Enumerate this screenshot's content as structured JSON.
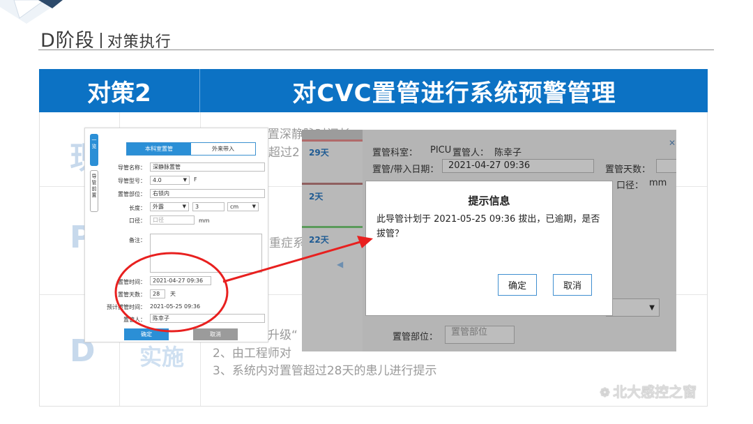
{
  "slide": {
    "title_main": "D阶段",
    "title_sub": "对策执行",
    "header_left": "对策2",
    "header_right": "对CVC置管进行系统预警管理",
    "watermark": "北大感控之窗",
    "colors": {
      "header": "#0c72c4",
      "accent_red": "#e8201f"
    }
  },
  "background_text": {
    "line1": "1、患儿留置深静脉时间长",
    "line2": "超过2",
    "line3": "重症系",
    "line4": "升级“",
    "line5": "2、由工程师对",
    "line6": "3、系统内对置管超过28天的患儿进行提示",
    "phase_word": "实施",
    "letter_1": "现",
    "letter_2": "P",
    "letter_3": "D"
  },
  "form": {
    "side_tabs": [
      "一览",
      "导管前置"
    ],
    "tabs": [
      "本科室置管",
      "外来带入"
    ],
    "fields": {
      "name_label": "导管名称：",
      "name_value": "深静脉置管",
      "type_label": "导管型号：",
      "type_value": "4.0",
      "type_unit": "F",
      "site_label": "置管部位：",
      "site_value": "右锁内",
      "length_label": "长度：",
      "length_select": "外露",
      "length_value": "3",
      "length_unit": "cm",
      "diameter_label": "口径：",
      "diameter_placeholder": "口径",
      "diameter_unit": "mm",
      "note_label": "备注：",
      "time_label": "置管时间：",
      "time_value": "2021-04-27   09:36",
      "days_label": "置管天数：",
      "days_value": "28",
      "days_unit": "天",
      "planned_label": "预计拔管时间：",
      "planned_value": "2021-05-25 09:36",
      "person_label": "置管人：",
      "person_value": "陈幸子"
    },
    "confirm_label": "确定",
    "cancel_label": "取消"
  },
  "system": {
    "strip_items": [
      "29天",
      "2天",
      "22天"
    ],
    "dept_label": "置管科室：",
    "dept_value": "PICU",
    "person_label": "置管人：",
    "person_value": "陈幸子",
    "date_label": "置管/带入日期：",
    "date_value": "2021-04-27   09:36",
    "days_label": "置管天数：",
    "diameter_label": "口径：",
    "diameter_unit": "mm",
    "site_label": "置管部位：",
    "site_placeholder": "置管部位"
  },
  "dialog": {
    "title": "提示信息",
    "message": "此导管计划于 2021-05-25 09:36 拔出，已逾期，是否拔管？",
    "ok_label": "确定",
    "cancel_label": "取消"
  }
}
